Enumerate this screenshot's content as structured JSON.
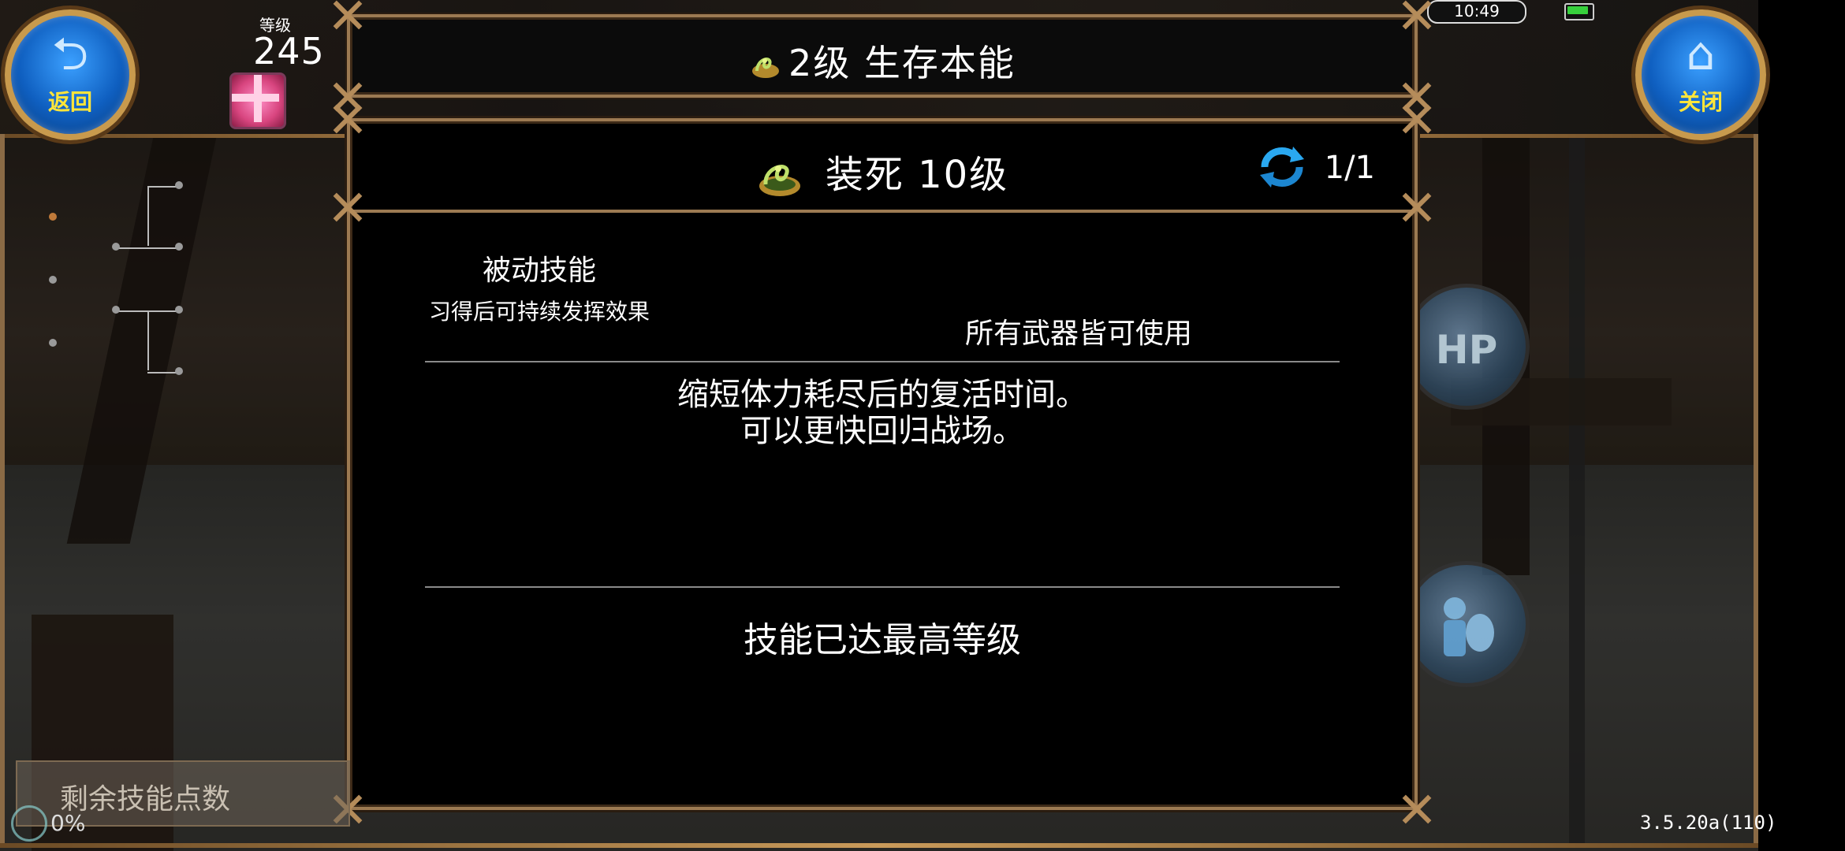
{
  "status_bar": {
    "time": "10:49",
    "battery_level": 0.85,
    "battery_color": "#37d03d"
  },
  "nav": {
    "back_label": "返回",
    "back_icon": "return-arrow-icon",
    "close_label": "关闭",
    "close_icon": "home-icon"
  },
  "player": {
    "level_label": "等级",
    "level_value": "245",
    "gift_icon": "gift-box-icon"
  },
  "header": {
    "title": "2级 生存本能",
    "icon": "snake-skill-icon"
  },
  "skill": {
    "name": "装死 10级",
    "icon": "snake-skill-icon",
    "page_indicator": "1/1",
    "page_icon": "refresh-icon",
    "type_title": "被动技能",
    "type_subtitle": "习得后可持续发挥效果",
    "weapon_note": "所有武器皆可使用",
    "description_line1": "缩短体力耗尽后的复活时间。",
    "description_line2": "可以更快回归战场。",
    "max_level_text": "技能已达最高等级"
  },
  "side_buttons": {
    "hp_label": "HP",
    "hp_icon": "hp-up-icon",
    "knight_icon": "knight-shield-icon"
  },
  "footer": {
    "points_label": "剩余技能点数",
    "xp_percent": "0%",
    "version": "3.5.20a(110)"
  },
  "colors": {
    "frame_gold": "#9c7a52",
    "button_blue": "#0f5fc0",
    "button_text_yellow": "#ffe53a"
  }
}
